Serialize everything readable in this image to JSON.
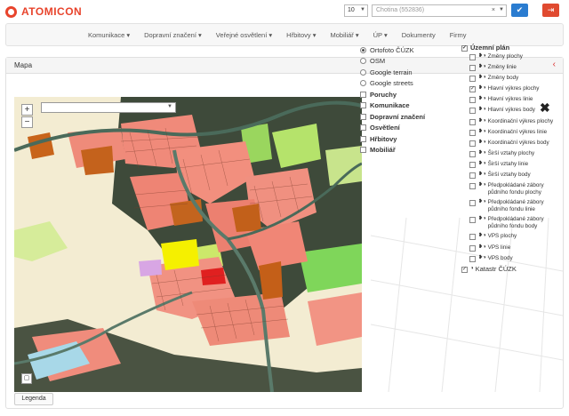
{
  "brand": {
    "name": "ATOMICON",
    "color": "#e8442c"
  },
  "header": {
    "page_size_value": "10",
    "object_select_value": "Chotina (552836)",
    "clear_icon": "×",
    "confirm_icon": "check-icon",
    "logout_icon": "logout-icon"
  },
  "nav": {
    "items": [
      "Komunikace ▾",
      "Dopravní značení ▾",
      "Veřejné osvětlení ▾",
      "Hřbitovy ▾",
      "Mobiliář ▾",
      "ÚP ▾",
      "Dokumenty",
      "Firmy"
    ]
  },
  "panel": {
    "title": "Mapa",
    "collapse_icon": "chevron-left-icon"
  },
  "map": {
    "zoom_in": "+",
    "zoom_out": "−",
    "legend_label": "Legenda"
  },
  "base_layers": [
    {
      "label": "Ortofoto ČÚZK",
      "selected": true
    },
    {
      "label": "OSM",
      "selected": false
    },
    {
      "label": "Google terrain",
      "selected": false
    },
    {
      "label": "Google streets",
      "selected": false
    }
  ],
  "overlay_layers": [
    {
      "label": "Poruchy",
      "checked": false
    },
    {
      "label": "Komunikace",
      "checked": false
    },
    {
      "label": "Dopravní značení",
      "checked": false
    },
    {
      "label": "Osvětlení",
      "checked": false
    },
    {
      "label": "Hřbitovy",
      "checked": false
    },
    {
      "label": "Mobiliář",
      "checked": false
    }
  ],
  "uzemni_plan": {
    "title": "Územní plán",
    "checked": true,
    "items": [
      {
        "label": "Změny plochy",
        "checked": false
      },
      {
        "label": "Změny linie",
        "checked": false
      },
      {
        "label": "Změny body",
        "checked": false
      },
      {
        "label": "Hlavní výkres plochy",
        "checked": true
      },
      {
        "label": "Hlavní výkres linie",
        "checked": false
      },
      {
        "label": "Hlavní výkres body",
        "checked": false
      },
      {
        "label": "Koordinační výkres plochy",
        "checked": false
      },
      {
        "label": "Koordinační výkres linie",
        "checked": false
      },
      {
        "label": "Koordinační výkres body",
        "checked": false
      },
      {
        "label": "Širší vztahy plochy",
        "checked": false
      },
      {
        "label": "Širší vztahy linie",
        "checked": false
      },
      {
        "label": "Širší vztahy body",
        "checked": false
      },
      {
        "label": "Předpokládané zábory půdního fondu plochy",
        "checked": false
      },
      {
        "label": "Předpokládané zábory půdního fondu linie",
        "checked": false
      },
      {
        "label": "Předpokládané zábory půdního fondu body",
        "checked": false
      },
      {
        "label": "VPS plochy",
        "checked": false
      },
      {
        "label": "VPS linie",
        "checked": false
      },
      {
        "label": "VPS body",
        "checked": false
      }
    ],
    "katastr": {
      "label": "Katastr ČÚZK",
      "checked": true
    }
  }
}
